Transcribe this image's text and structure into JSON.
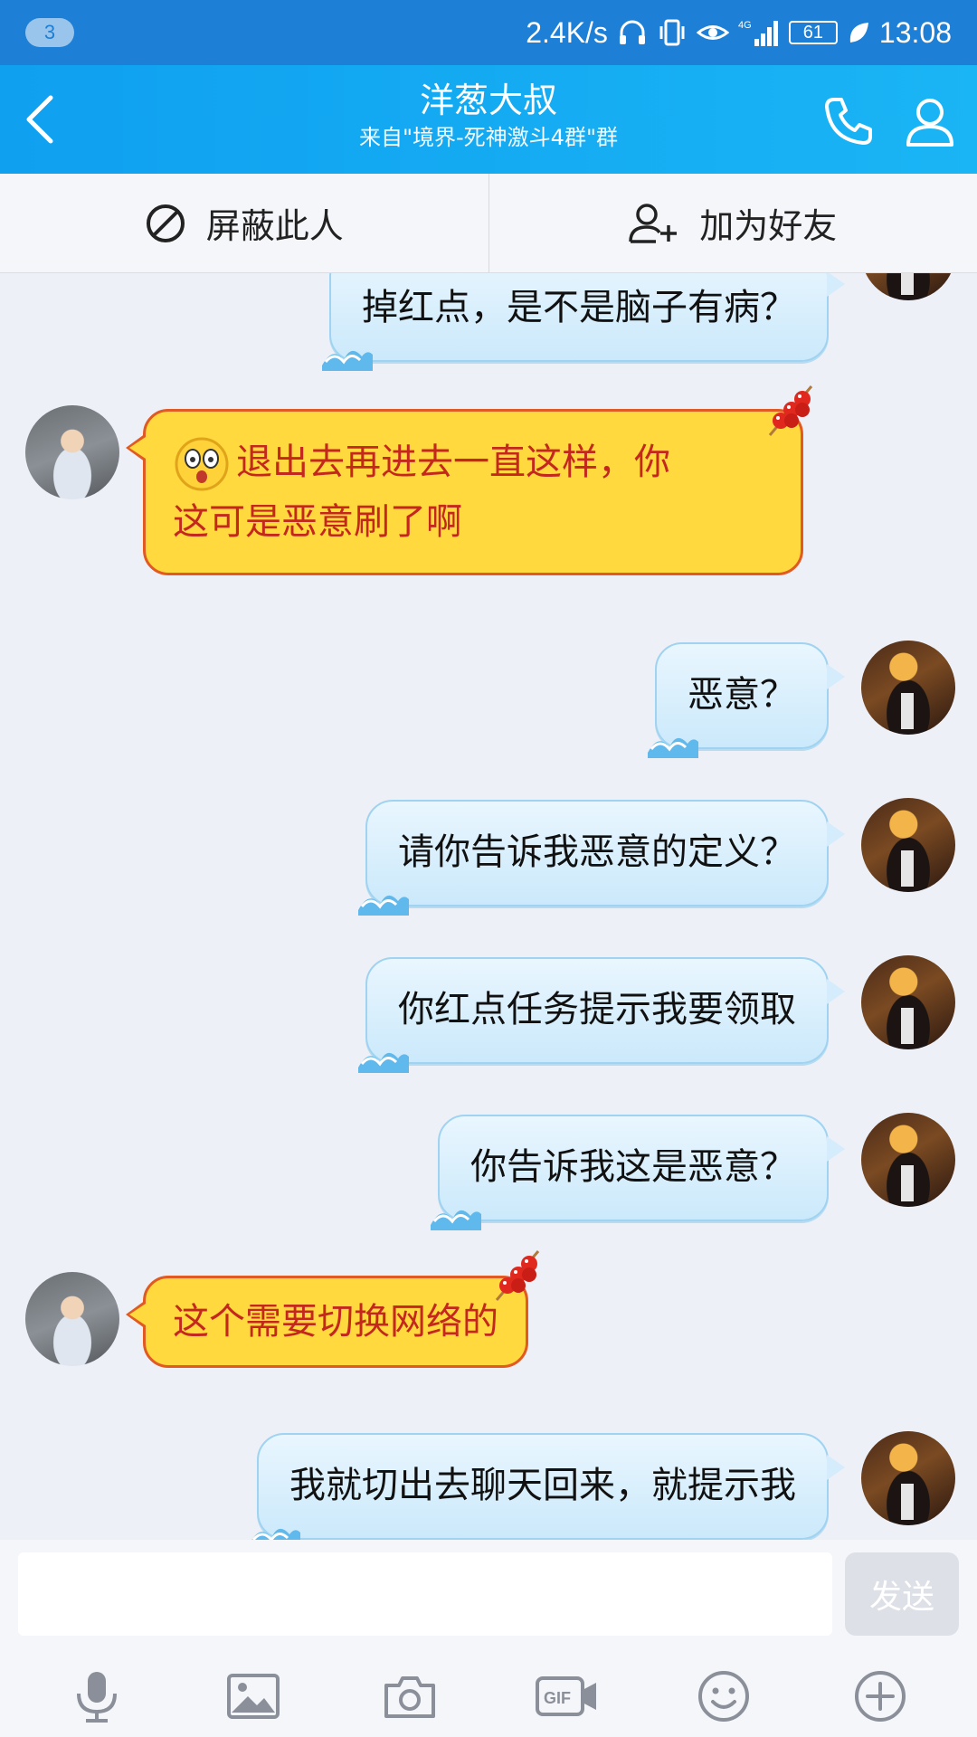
{
  "status_bar": {
    "notification_count": "3",
    "net_speed": "2.4K/s",
    "network_label": "4G",
    "battery": "61",
    "time": "13:08"
  },
  "header": {
    "title": "洋葱大叔",
    "subtitle": "来自\"境界-死神激斗4群\"群",
    "accent_color": "#12a6f3"
  },
  "actions": {
    "block_label": "屏蔽此人",
    "add_friend_label": "加为好友"
  },
  "messages": [
    {
      "side": "right",
      "style": "blue",
      "text": "掉红点，是不是脑子有病？"
    },
    {
      "side": "left",
      "style": "yellow",
      "text_line1": "退出去再进去一直这样，你",
      "text_line2": "这可是恶意刷了啊",
      "emoji": "shocked-face"
    },
    {
      "side": "right",
      "style": "blue",
      "text": "恶意？"
    },
    {
      "side": "right",
      "style": "blue",
      "text": "请你告诉我恶意的定义？"
    },
    {
      "side": "right",
      "style": "blue",
      "text": "你红点任务提示我要领取"
    },
    {
      "side": "right",
      "style": "blue",
      "text": "你告诉我这是恶意？"
    },
    {
      "side": "left",
      "style": "yellow",
      "text": "这个需要切换网络的"
    },
    {
      "side": "right",
      "style": "blue",
      "text": "我就切出去聊天回来，就提示我"
    }
  ],
  "input": {
    "value": "",
    "send_label": "发送"
  },
  "toolbar": {
    "icons": [
      "microphone-icon",
      "image-icon",
      "camera-icon",
      "gif-icon",
      "emoji-icon",
      "plus-icon"
    ],
    "gif_label": "GIF"
  },
  "colors": {
    "bubble_blue": "#d4ecfb",
    "bubble_yellow": "#ffd93d",
    "yellow_text": "#c4271d"
  }
}
